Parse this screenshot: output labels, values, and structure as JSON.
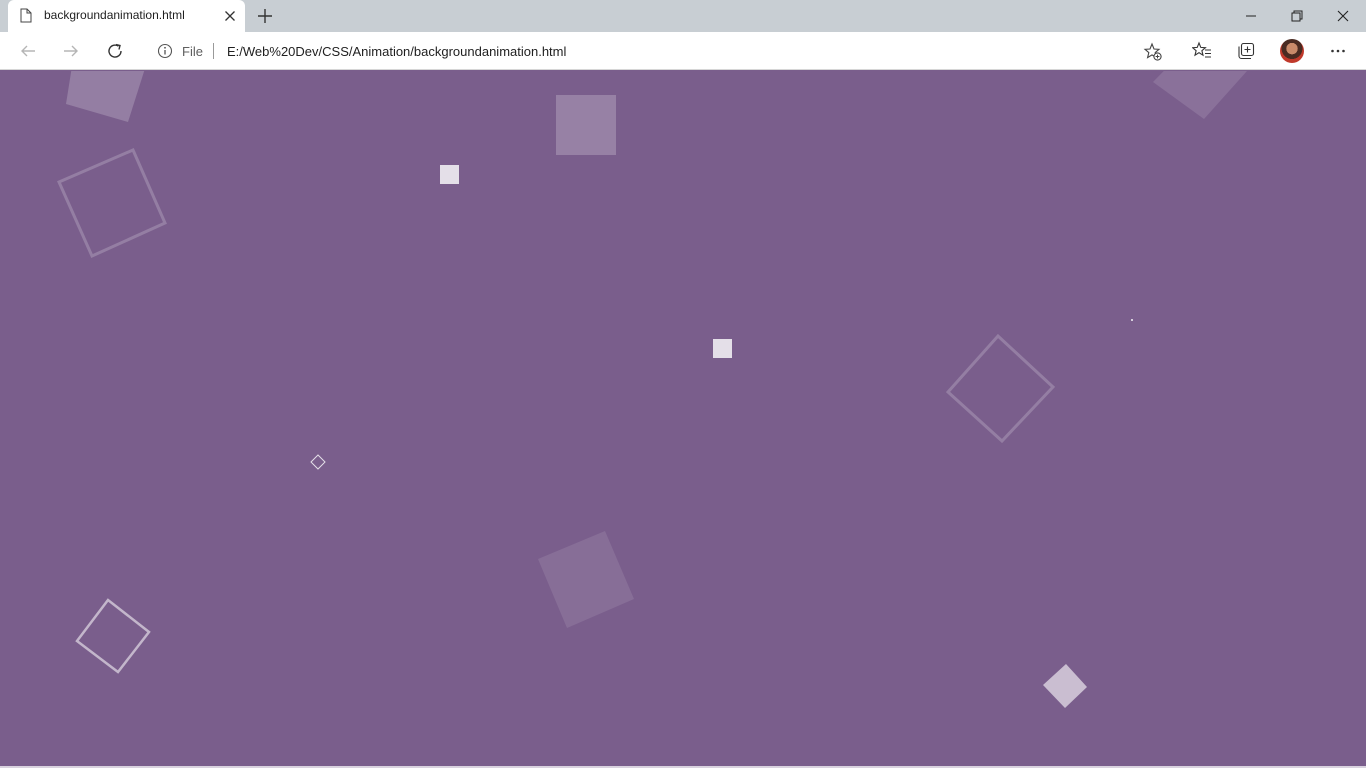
{
  "browser": {
    "tab": {
      "title": "backgroundanimation.html",
      "page_icon": "page-icon",
      "close_icon": "close-icon"
    },
    "new_tab_icon": "plus-icon",
    "window_controls": [
      "minimize-icon",
      "restore-icon",
      "close-icon"
    ],
    "toolbar": {
      "back_icon": "arrow-left-icon",
      "forward_icon": "arrow-right-icon",
      "reload_icon": "reload-icon",
      "address_bar": {
        "info_icon": "info-icon",
        "scheme_label": "File",
        "url": "E:/Web%20Dev/CSS/Animation/backgroundanimation.html",
        "add_favorite_icon": "star-add-icon"
      },
      "favorites_icon": "favorites-icon",
      "collections_icon": "collections-icon",
      "profile_icon": "avatar",
      "more_icon": "more-icon"
    }
  },
  "page": {
    "background_color": "#7a5e8c",
    "shape_color": "#ffffff"
  }
}
